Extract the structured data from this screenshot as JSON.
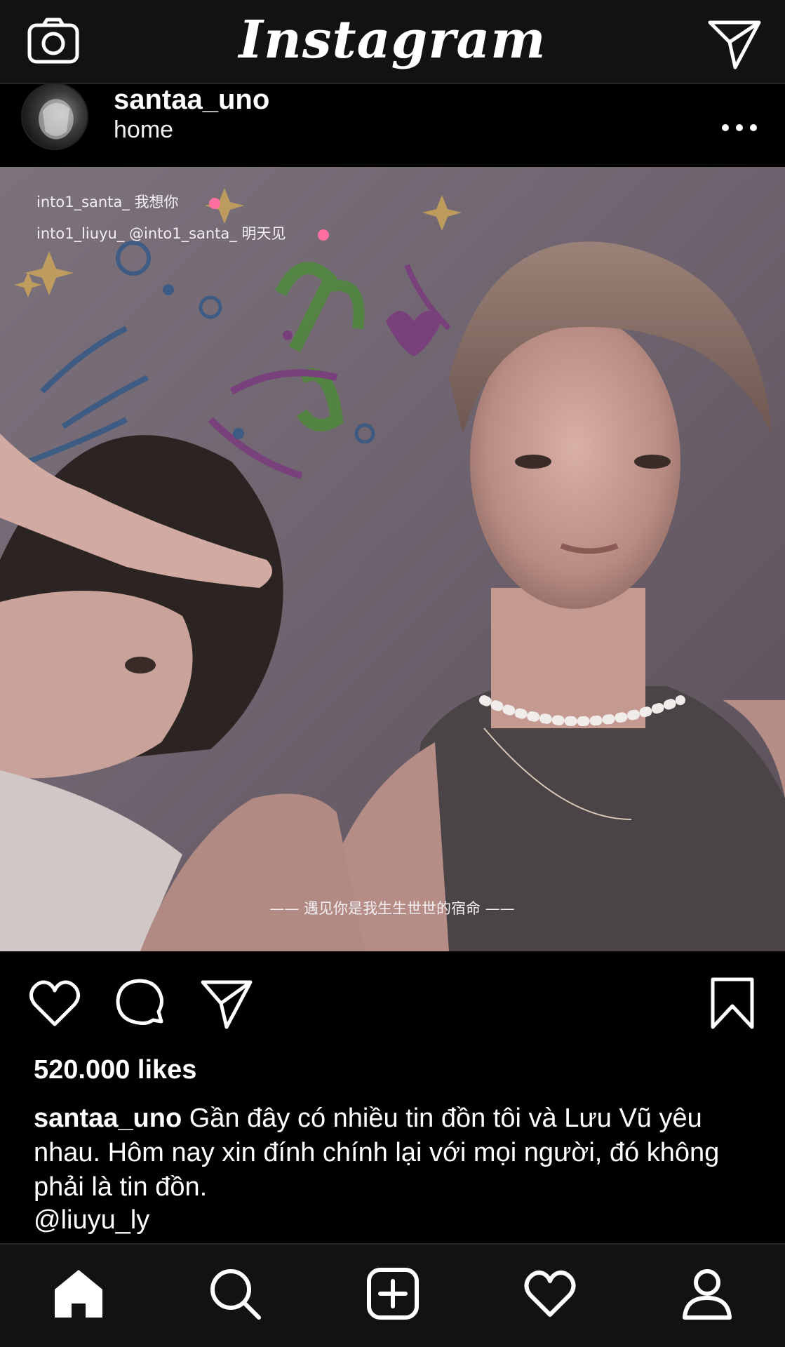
{
  "app": {
    "title": "Instagram",
    "icons": {
      "camera": "camera-icon",
      "direct": "direct-message-icon"
    }
  },
  "post": {
    "username": "santaa_uno",
    "location": "home",
    "likes": "520.000 likes",
    "caption_user": "santaa_uno",
    "caption_text": "Gần đây có nhiều tin đồn tôi và Lưu Vũ yêu nhau. Hôm nay xin đính chính lại với mọi người, đó không phải là tin đồn.",
    "mention": "@liuyu_ly",
    "image": {
      "overlay_line1": "into1_santa_ 我想你",
      "overlay_line2": "into1_liuyu_ @into1_santa_ 明天见",
      "subtitle": "—— 遇见你是我生生世世的宿命 ——"
    }
  },
  "nav": {
    "items": [
      "home-icon",
      "search-icon",
      "new-post-icon",
      "activity-icon",
      "profile-icon"
    ]
  },
  "colors": {
    "bar": "#121212",
    "background": "#000000",
    "text": "#ffffff",
    "heart": "#ff6fa0"
  }
}
